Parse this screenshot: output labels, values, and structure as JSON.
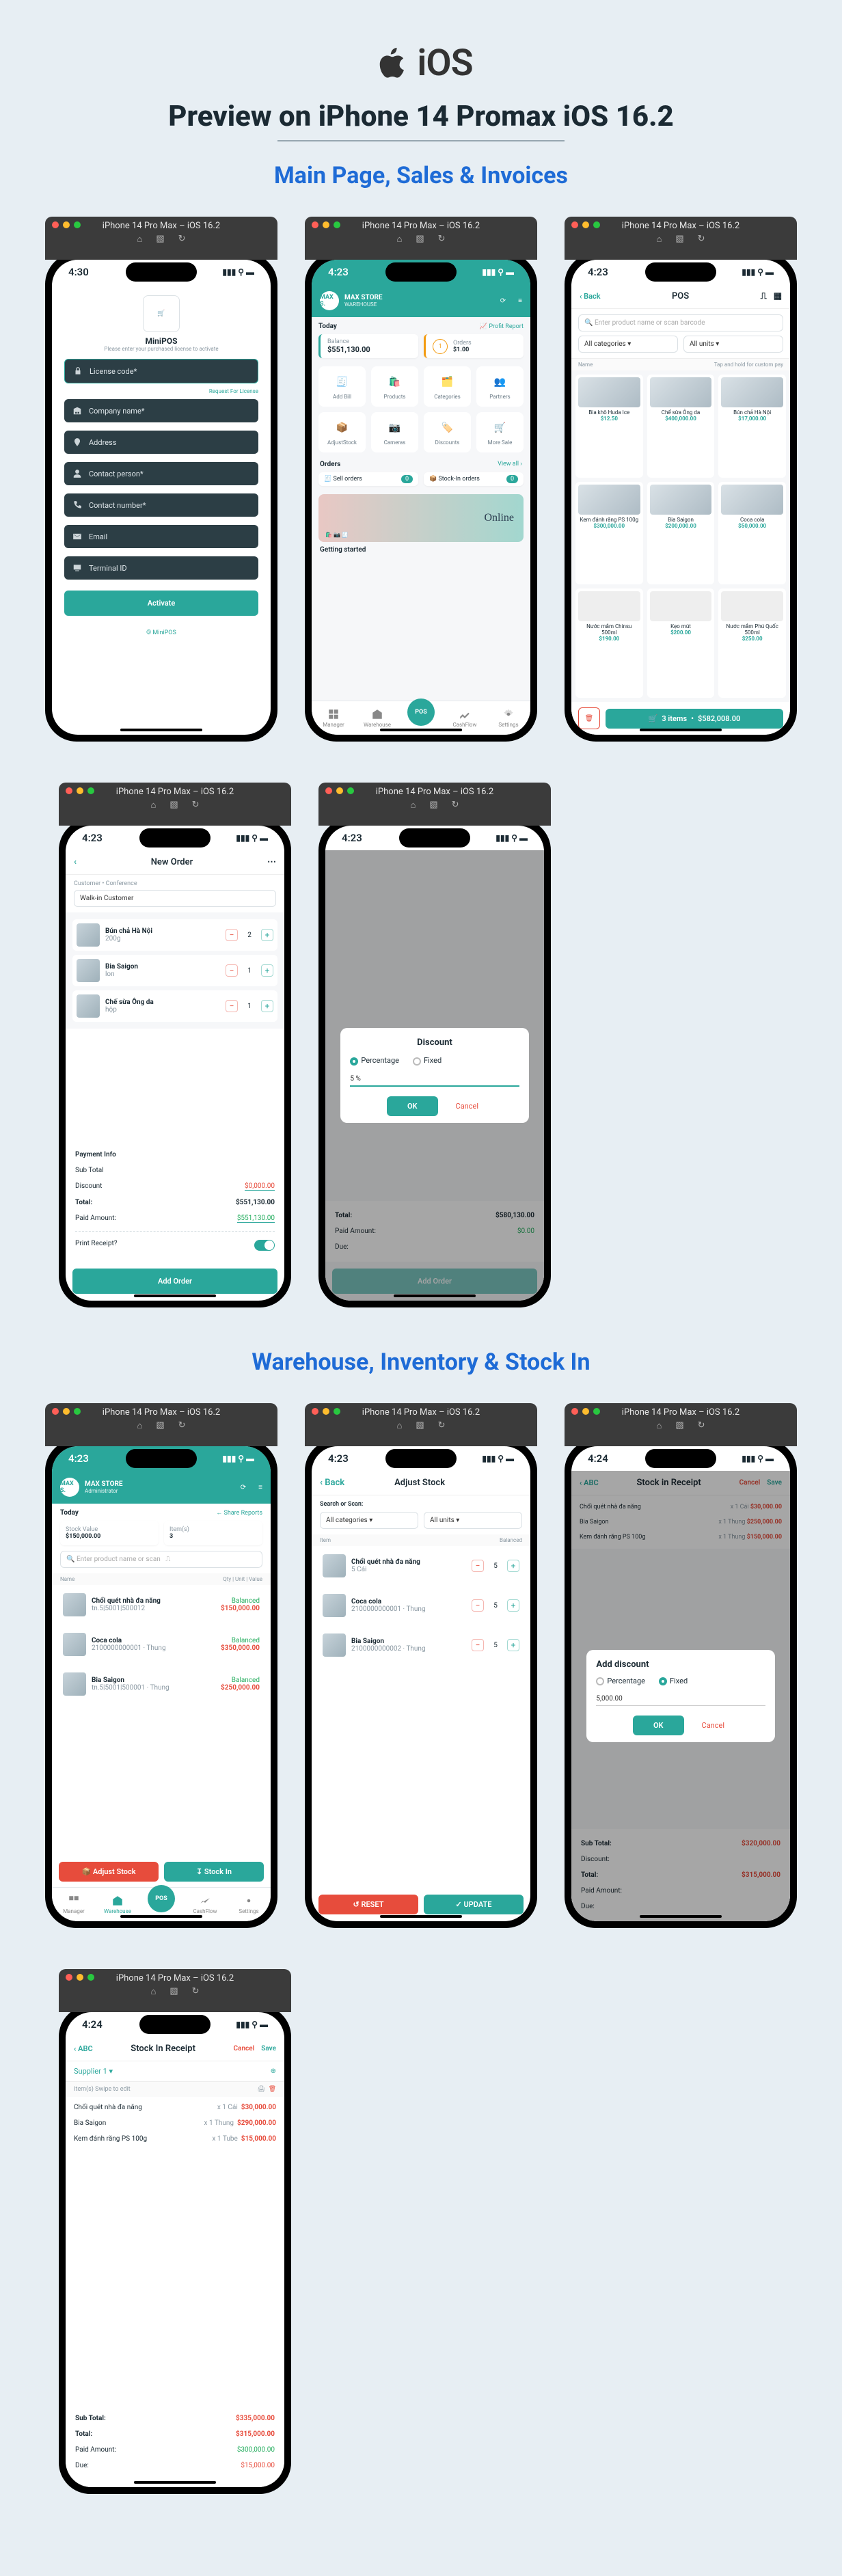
{
  "hero": {
    "ios_label": "iOS",
    "title": "Preview on iPhone 14 Promax iOS 16.2"
  },
  "sections": {
    "s1": "Main Page, Sales & Invoices",
    "s2": "Warehouse, Inventory & Stock In"
  },
  "win_title": "iPhone 14 Pro Max – iOS 16.2",
  "times": {
    "a": "4:30",
    "b": "4:23",
    "c": "4:24"
  },
  "activate": {
    "app": "MiniPOS",
    "sub": "Please enter your purchased license to activate",
    "fields": {
      "license": "License code*",
      "company": "Company name*",
      "address": "Address",
      "person": "Contact person*",
      "phone": "Contact number*",
      "email": "Email",
      "terminal": "Terminal ID"
    },
    "request": "Request For License",
    "btn": "Activate",
    "footer": "© MiniPOS"
  },
  "dash": {
    "store": "MAX STORE",
    "sub": "WAREHOUSE",
    "today": "Today",
    "pl": "Profit Report",
    "balance_lbl": "Balance",
    "balance": "$551,130.00",
    "orders_lbl": "Orders",
    "orders_n": "1",
    "orders_amt": "$1.00",
    "tiles": {
      "addbill": "Add Bill",
      "products": "Products",
      "categories": "Categories",
      "partners": "Partners",
      "adjuststock": "AdjustStock",
      "cameras": "Cameras",
      "discounts": "Discounts",
      "moresale": "More Sale"
    },
    "orders_head": "Orders",
    "viewall": "View all",
    "sell": "Sell orders",
    "stockin": "Stock-In orders",
    "nums": {
      "a": "0",
      "b": "0"
    },
    "online": "Online",
    "gs": "Getting started",
    "nav": {
      "manager": "Manager",
      "warehouse": "Warehouse",
      "cashflow": "CashFlow",
      "settings": "Settings",
      "pos": "POS"
    }
  },
  "pos": {
    "back": "Back",
    "title": "POS",
    "search_ph": "Enter product name or scan barcode",
    "cats_lbl": "All categories",
    "units_lbl": "All units",
    "note": "Tap and hold for custom pay",
    "items": [
      {
        "name": "Bia khô Huda Ice",
        "price": "$12.50"
      },
      {
        "name": "Chế sừa Ông da",
        "price": "$400,000.00"
      },
      {
        "name": "Bún chả Hà Nội",
        "price": "$17,000.00"
      },
      {
        "name": "Kem đánh răng PS 100g",
        "price": "$300,000.00"
      },
      {
        "name": "Bia Saigon",
        "price": "$200,000.00"
      },
      {
        "name": "Coca cola",
        "price": "$50,000.00"
      },
      {
        "name": "Nước mắm Chinsu 500ml",
        "price": "$190.00"
      },
      {
        "name": "Kẹo mút",
        "price": "$200.00"
      },
      {
        "name": "Nước mắm Phú Quốc 500ml",
        "price": "$250.00"
      }
    ],
    "cart": {
      "qty": "3 items",
      "total": "$582,008.00"
    }
  },
  "new_order": {
    "title": "New Order",
    "customer_ph": "Walk-in Customer",
    "lines": [
      {
        "name": "Bún chả Hà Nội",
        "qty": "2",
        "price": "",
        "unit": "200g"
      },
      {
        "name": "Bia Saigon",
        "qty": "1",
        "price": "",
        "unit": "lon"
      },
      {
        "name": "Chế sừa Ông da",
        "qty": "1",
        "price": "",
        "unit": "hộp"
      }
    ],
    "pay_head": "Payment Info",
    "subtotal_lbl": "Sub Total",
    "subtotal": "",
    "discount_lbl": "Discount",
    "discount": "$0,000.00",
    "total_lbl": "Total:",
    "total": "$551,130.00",
    "paid_lbl": "Paid Amount:",
    "paid": "$551,130.00",
    "print_lbl": "Print Receipt?",
    "btn": "Add Order"
  },
  "disc_modal": {
    "title": "Discount",
    "percentage": "Percentage",
    "fixed": "Fixed",
    "value": "5 %",
    "ok": "OK",
    "cancel": "Cancel",
    "below": {
      "total_lbl": "Total:",
      "total": "$580,130.00",
      "paid_lbl": "Paid Amount:",
      "paid": "$0.00",
      "due_lbl": "Due:",
      "due": ""
    }
  },
  "warehouse": {
    "store": "MAX STORE",
    "sub": "Administrator",
    "share": "Share Reports",
    "today": "Today",
    "stockval_lbl": "Stock Value",
    "stockval": "$150,000.00",
    "items_lbl": "Item(s)",
    "items": "3",
    "search_ph": "Enter product name or scan",
    "cols": {
      "name": "Name",
      "qty": "Qty",
      "unit": "Unit",
      "value": "Value"
    },
    "rows": [
      {
        "name": "Chổi quét nhà đa năng",
        "sku": "tn.5|5001|500012",
        "status": "Balanced",
        "val": "$150,000.00"
      },
      {
        "name": "Coca cola",
        "sku": "2100000000001 · Thung",
        "status": "Balanced",
        "val": "$350,000.00"
      },
      {
        "name": "Bia Saigon",
        "sku": "tn.5|5001|500001 · Thung",
        "status": "Balanced",
        "val": "$250,000.00"
      }
    ],
    "adjust": "Adjust Stock",
    "stockin": "Stock In"
  },
  "adjust": {
    "back": "Back",
    "title": "Adjust Stock",
    "head": "Search or Scan:",
    "cats": "All categories",
    "units": "All units",
    "item_lbl": "Item",
    "bal_lbl": "Balanced",
    "rows": [
      {
        "name": "Chổi quét nhà đa năng",
        "sub": "5 Cái",
        "q": "5"
      },
      {
        "name": "Coca cola",
        "sub": "2100000000001 · Thung",
        "q": "5"
      },
      {
        "name": "Bia Saigon",
        "sub": "2100000000002 · Thung",
        "q": "5"
      }
    ],
    "reset": "RESET",
    "update": "UPDATE"
  },
  "add_disc": {
    "back": "ABC",
    "title": "Stock in Receipt",
    "cancel": "Cancel",
    "save": "Save",
    "dim_rows": [
      {
        "name": "Chổi quét nhà đa năng",
        "unit": "x 1 Cái",
        "amt": "$30,000.00"
      },
      {
        "name": "Bia Saigon",
        "unit": "x 1 Thung",
        "amt": "$250,000.00"
      },
      {
        "name": "Kem đánh răng PS 100g",
        "unit": "x 1 Thung",
        "amt": "$150,000.00"
      }
    ],
    "modal_title": "Add discount",
    "percentage": "Percentage",
    "fixed": "Fixed",
    "value": "5,000.00",
    "ok": "OK",
    "mcancel": "Cancel",
    "sum": {
      "sub_lbl": "Sub Total:",
      "sub": "$320,000.00",
      "disc_lbl": "Discount:",
      "total_lbl": "Total:",
      "total": "$315,000.00",
      "paid_lbl": "Paid Amount:",
      "due_lbl": "Due:"
    }
  },
  "receipt": {
    "back": "ABC",
    "title": "Stock In Receipt",
    "cancel": "Cancel",
    "save": "Save",
    "supplier": "Supplier 1",
    "swipe": "Swipe to edit",
    "items_lbl": "Item(s)",
    "rows": [
      {
        "name": "Chổi quét nhà đa năng",
        "unit": "x 1 Cái",
        "amt": "$30,000.00"
      },
      {
        "name": "Bia Saigon",
        "unit": "x 1 Thung",
        "amt": "$290,000.00"
      },
      {
        "name": "Kem đánh răng PS 100g",
        "unit": "x 1 Tube",
        "amt": "$15,000.00"
      }
    ],
    "sum": {
      "sub_lbl": "Sub Total:",
      "sub": "$335,000.00",
      "total_lbl": "Total:",
      "total": "$315,000.00",
      "paid_lbl": "Paid Amount:",
      "paid": "$300,000.00",
      "due_lbl": "Due:",
      "due": "$15,000.00"
    }
  }
}
